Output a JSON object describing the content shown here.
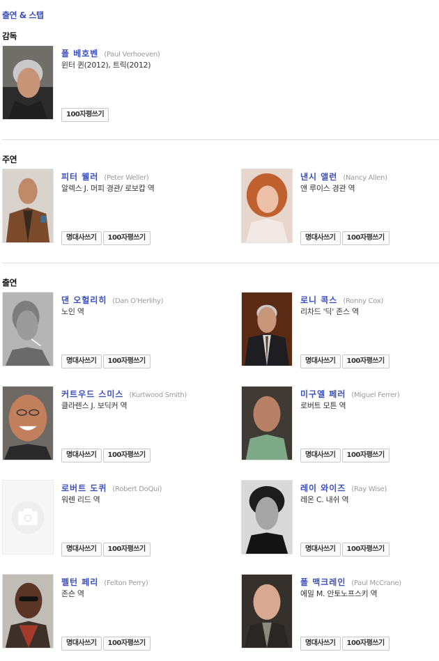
{
  "title": "출연 & 스탭",
  "sections": [
    {
      "heading": "감독",
      "people": [
        {
          "name_ko": "폴 베호벤",
          "name_en": "(Paul Verhoeven)",
          "role": "윈터 퀸(2012), 트릭(2012)",
          "buttons": [
            "100자평쓰기"
          ],
          "photo": "portrait-gray-hair"
        }
      ]
    },
    {
      "heading": "주연",
      "people": [
        {
          "name_ko": "피터 웰러",
          "name_en": "(Peter Weller)",
          "role": "알렉스 J. 머피 경관/ 로보캅 역",
          "buttons": [
            "명대사쓰기",
            "100자평쓰기"
          ],
          "photo": "portrait-leather-jacket"
        },
        {
          "name_ko": "낸시 앨런",
          "name_en": "(Nancy Allen)",
          "role": "앤 루이스 경관 역",
          "buttons": [
            "명대사쓰기",
            "100자평쓰기"
          ],
          "photo": "portrait-red-hair"
        }
      ]
    },
    {
      "heading": "출연",
      "people": [
        {
          "name_ko": "댄 오헐리히",
          "name_en": "(Dan O'Herlihy)",
          "role": "노인 역",
          "buttons": [
            "명대사쓰기",
            "100자평쓰기"
          ],
          "photo": "portrait-bw-cigarette"
        },
        {
          "name_ko": "로니 콕스",
          "name_en": "(Ronny Cox)",
          "role": "리차드 '딕' 존스 역",
          "buttons": [
            "명대사쓰기",
            "100자평쓰기"
          ],
          "photo": "portrait-suit"
        },
        {
          "name_ko": "커트우드 스미스",
          "name_en": "(Kurtwood Smith)",
          "role": "클라렌스 J. 보딕커 역",
          "buttons": [
            "명대사쓰기",
            "100자평쓰기"
          ],
          "photo": "portrait-bald-glasses"
        },
        {
          "name_ko": "미구엘 페러",
          "name_en": "(Miguel Ferrer)",
          "role": "로버트 모튼 역",
          "buttons": [
            "명대사쓰기",
            "100자평쓰기"
          ],
          "photo": "portrait-green-shirt"
        },
        {
          "name_ko": "로버트 도퀴",
          "name_en": "(Robert DoQui)",
          "role": "워렌 리드 역",
          "buttons": [
            "명대사쓰기",
            "100자평쓰기"
          ],
          "photo": "camera-placeholder"
        },
        {
          "name_ko": "레이 와이즈",
          "name_en": "(Ray Wise)",
          "role": "레온 C. 내쉬 역",
          "buttons": [
            "명대사쓰기",
            "100자평쓰기"
          ],
          "photo": "portrait-bw-dark-hair"
        },
        {
          "name_ko": "펠턴 페리",
          "name_en": "(Felton Perry)",
          "role": "존슨 역",
          "buttons": [
            "명대사쓰기",
            "100자평쓰기"
          ],
          "photo": "portrait-sunglasses"
        },
        {
          "name_ko": "폴 맥크레인",
          "name_en": "(Paul McCrane)",
          "role": "에밀 M. 안토노프스키 역",
          "buttons": [
            "명대사쓰기",
            "100자평쓰기"
          ],
          "photo": "portrait-bald-tie"
        }
      ]
    }
  ]
}
